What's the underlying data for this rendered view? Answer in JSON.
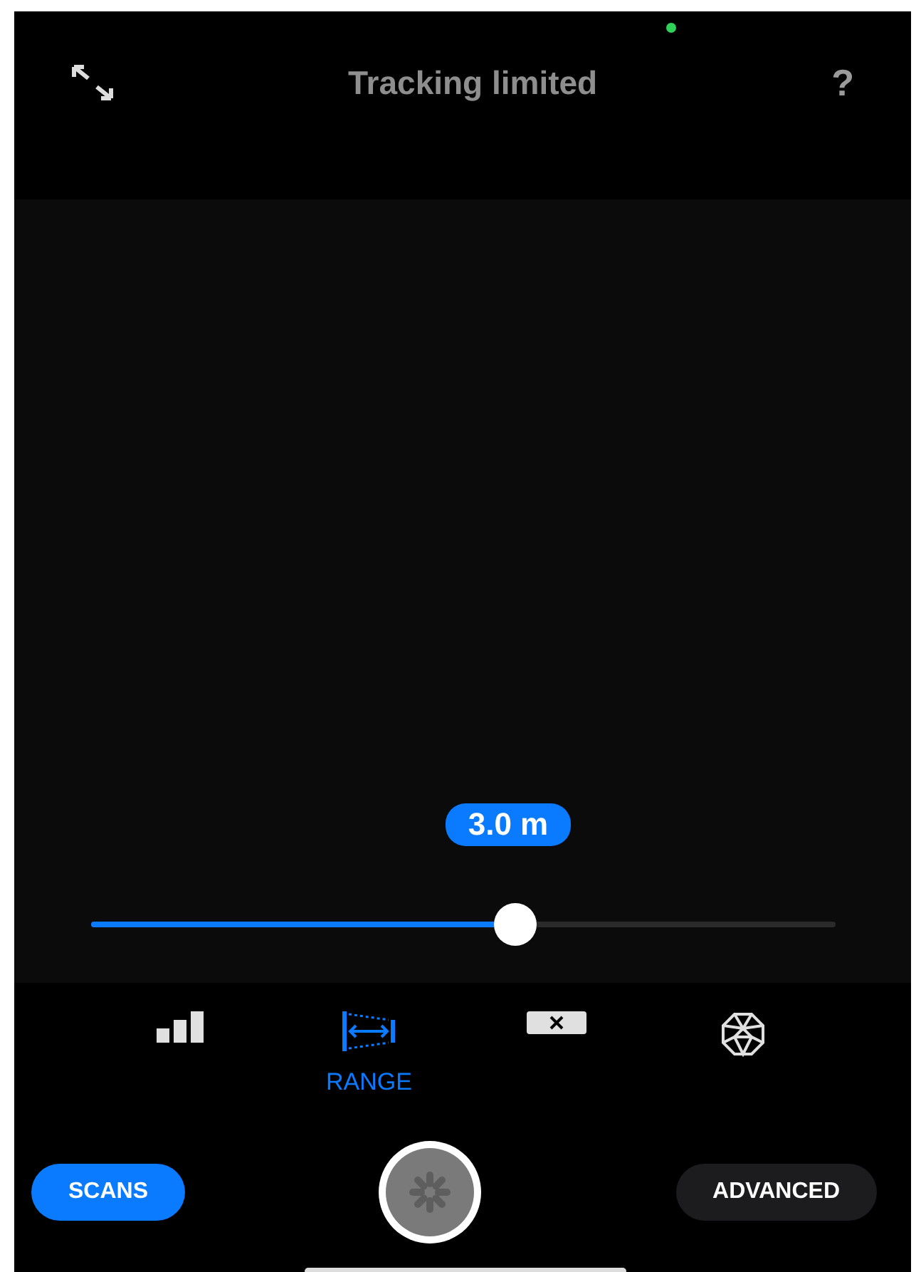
{
  "header": {
    "title": "Tracking limited",
    "help": "?"
  },
  "range": {
    "reading": "3.0 m",
    "level": 0.57
  },
  "tools": [
    {
      "kind": "bars",
      "selected": false
    },
    {
      "kind": "range",
      "selected": true,
      "label": "RANGE"
    },
    {
      "kind": "clear",
      "selected": false
    },
    {
      "kind": "mesh",
      "selected": false
    }
  ],
  "bottom": {
    "left": "SCANS",
    "right": "ADVANCED"
  }
}
